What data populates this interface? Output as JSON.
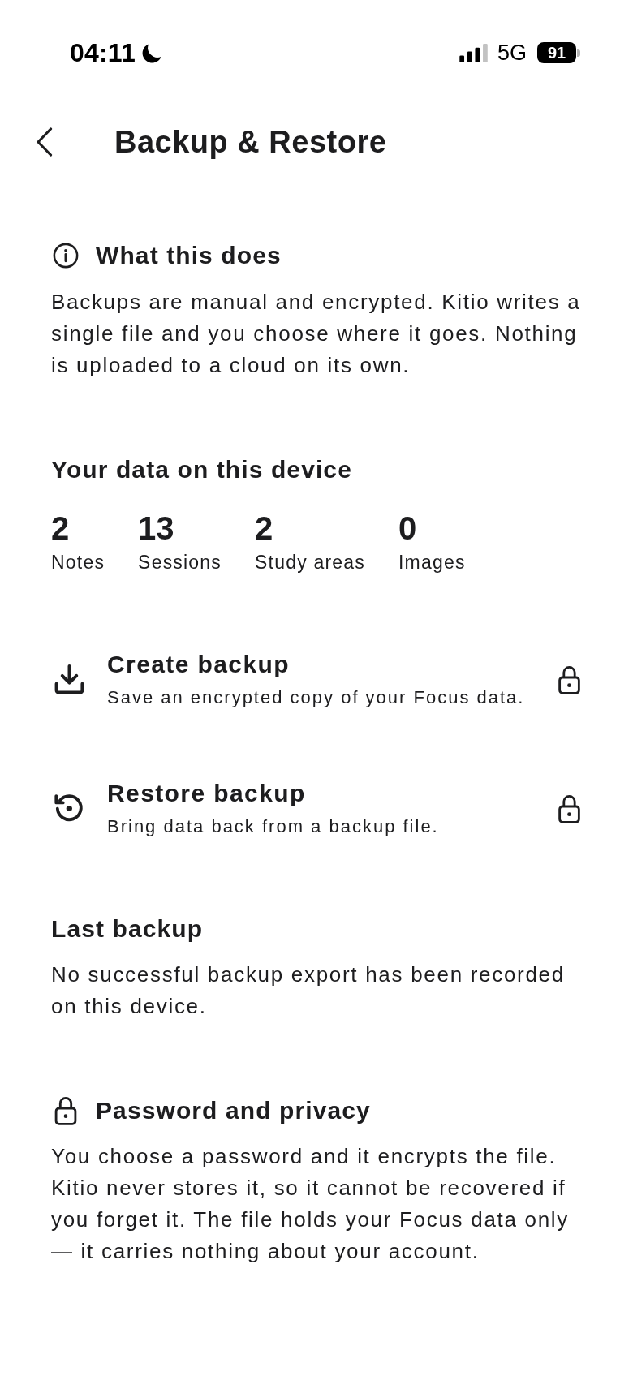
{
  "status_bar": {
    "time": "04:11",
    "network": "5G",
    "battery": "91"
  },
  "header": {
    "title": "Backup & Restore"
  },
  "about": {
    "heading": "What this does",
    "body": "Backups are manual and encrypted. Kitio writes a single file and you choose where it goes. Nothing is uploaded to a cloud on its own."
  },
  "device_data": {
    "heading": "Your data on this device",
    "stats": [
      {
        "value": "2",
        "label": "Notes"
      },
      {
        "value": "13",
        "label": "Sessions"
      },
      {
        "value": "2",
        "label": "Study areas"
      },
      {
        "value": "0",
        "label": "Images"
      }
    ]
  },
  "actions": [
    {
      "kind": "create",
      "title": "Create backup",
      "subtitle": "Save an encrypted copy of your Focus data.",
      "locked": true
    },
    {
      "kind": "restore",
      "title": "Restore backup",
      "subtitle": "Bring data back from a backup file.",
      "locked": true
    }
  ],
  "last_backup": {
    "heading": "Last backup",
    "body": "No successful backup export has been recorded on this device."
  },
  "privacy": {
    "heading": "Password and privacy",
    "body": "You choose a password and it encrypts the file. Kitio never stores it, so it cannot be recovered if you forget it. The file holds your Focus data only — it carries nothing about your account."
  }
}
